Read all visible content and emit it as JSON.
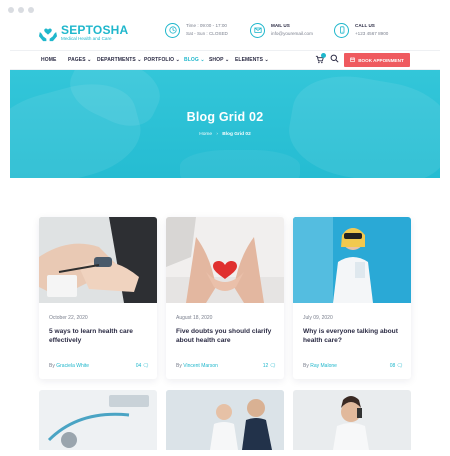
{
  "brand": {
    "name": "SEPTOSHA",
    "tagline": "Medical Health and Care",
    "accent": "#1fb7cc",
    "cta_color": "#ef5a5f"
  },
  "header": {
    "time": {
      "line1": "Time : 09:00 - 17:00",
      "line2": "Sat - Sun : CLOSED",
      "icon": "clock-icon"
    },
    "mail": {
      "label": "MAIL US",
      "value": "info@youremail.com",
      "icon": "mail-icon"
    },
    "call": {
      "label": "CALL US",
      "value": "+123 4567 8900",
      "icon": "phone-icon"
    }
  },
  "nav": {
    "items": [
      {
        "label": "HOME"
      },
      {
        "label": "PAGES"
      },
      {
        "label": "DEPARTMENTS"
      },
      {
        "label": "PORTFOLIO"
      },
      {
        "label": "BLOG"
      },
      {
        "label": "SHOP"
      },
      {
        "label": "ELEMENTS"
      }
    ],
    "book_label": "BOOK APPOINMENT"
  },
  "hero": {
    "title": "Blog Grid 02",
    "breadcrumb": {
      "home": "Home",
      "sep": "›",
      "current": "Blog Grid 02"
    }
  },
  "posts": [
    {
      "date": "October 22, 2020",
      "title": "5 ways to learn health care effectively",
      "author_prefix": "By ",
      "author": "Graciela White",
      "comments": "04"
    },
    {
      "date": "August 18, 2020",
      "title": "Five doubts you should clarify about health care",
      "author_prefix": "By ",
      "author": "Vincent Marson",
      "comments": "12"
    },
    {
      "date": "July 09, 2020",
      "title": "Why is everyone talking about health care?",
      "author_prefix": "By ",
      "author": "Ray Malone",
      "comments": "08"
    }
  ]
}
